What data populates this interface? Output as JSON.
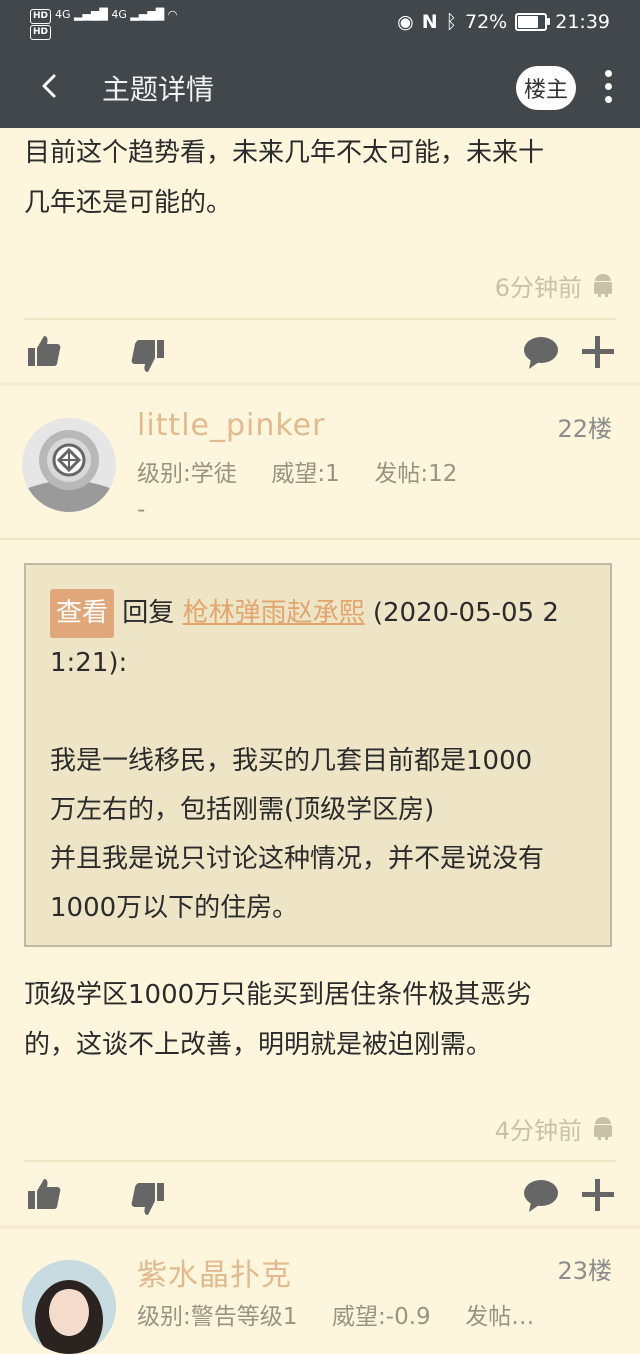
{
  "status_bar": {
    "network_left": "4G",
    "network_right": "4G",
    "battery": "72%",
    "time": "21:39"
  },
  "appbar": {
    "title": "主题详情",
    "op_label": "楼主"
  },
  "post_prev": {
    "lines": [
      "目前这个趋势看，未来几年不太可能，未来十",
      "几年还是可能的。"
    ],
    "time": "6分钟前"
  },
  "post_22": {
    "username": "little_pinker",
    "floor": "22楼",
    "level_label": "级别:学徒",
    "prestige_label": "威望:1",
    "posts_label": "发帖:12",
    "extra": "-",
    "quote": {
      "tag": "查看",
      "reply_prefix": "回复",
      "reply_user": "枪林弹雨赵承熙",
      "reply_time_a": "(2020-05-05 2",
      "reply_time_b": "1:21):",
      "lines": [
        "我是一线移民，我买的几套目前都是1000",
        "万左右的，包括刚需(顶级学区房)",
        "并且我是说只讨论这种情况，并不是说没有",
        "1000万以下的住房。"
      ]
    },
    "body_lines": [
      "顶级学区1000万只能买到居住条件极其恶劣",
      "的，这谈不上改善，明明就是被迫刚需。"
    ],
    "time": "4分钟前"
  },
  "post_23": {
    "username": "紫水晶扑克",
    "floor": "23楼",
    "level_label": "级别:警告等级1",
    "prestige_label": "威望:-0.9",
    "posts_label": "发帖…"
  },
  "colors": {
    "appbar": "#42474b",
    "background": "#fdf6dc",
    "username": "#e3b98e",
    "quote_bg": "#ede5c6"
  }
}
